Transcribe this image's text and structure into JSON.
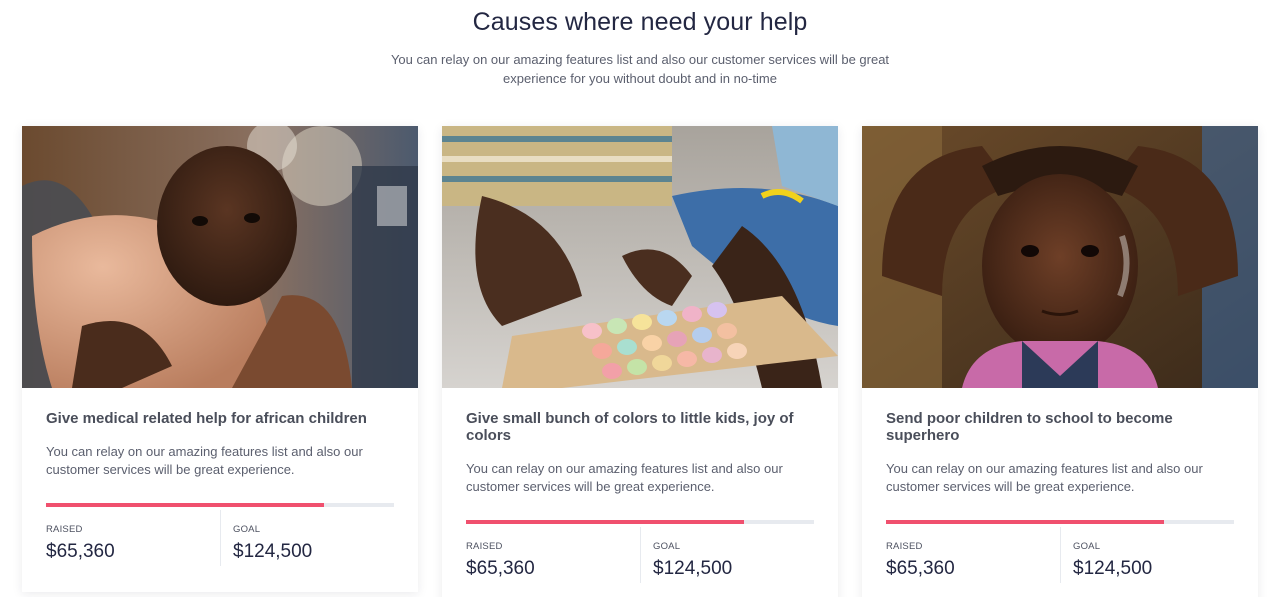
{
  "section": {
    "title": "Causes where need your help",
    "subtitle": "You can relay on our amazing features list and also our customer services will be great experience for you without doubt and in no-time"
  },
  "causes": [
    {
      "title": "Give medical related help for african children",
      "description": "You can relay on our amazing features list and also our customer services will be great experience.",
      "progress": 0.8,
      "raised_label": "RAISED",
      "raised_value": "$65,360",
      "goal_label": "GOAL",
      "goal_value": "$124,500"
    },
    {
      "title": "Give small bunch of colors to little kids, joy of colors",
      "description": "You can relay on our amazing features list and also our customer services will be great experience.",
      "progress": 0.8,
      "raised_label": "RAISED",
      "raised_value": "$65,360",
      "goal_label": "GOAL",
      "goal_value": "$124,500"
    },
    {
      "title": "Send poor children to school to become superhero",
      "description": "You can relay on our amazing features list and also our customer services will be great experience.",
      "progress": 0.8,
      "raised_label": "RAISED",
      "raised_value": "$65,360",
      "goal_label": "GOAL",
      "goal_value": "$124,500"
    }
  ],
  "colors": {
    "progress_fill": "#f0506e",
    "progress_track": "#e7eaef",
    "heading": "#232742"
  }
}
